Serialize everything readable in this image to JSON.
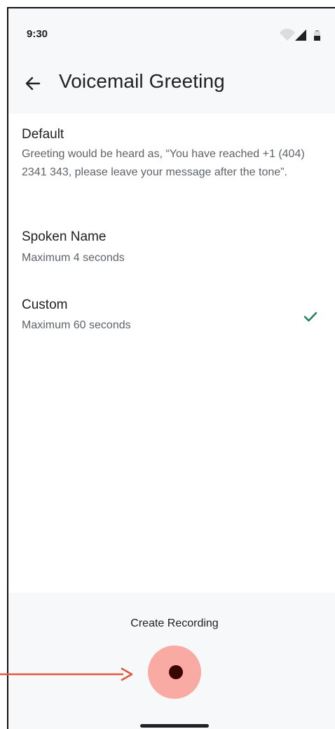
{
  "status_bar": {
    "time": "9:30",
    "icons": [
      "wifi-icon",
      "cellular-signal-icon",
      "battery-icon"
    ]
  },
  "header": {
    "back_icon": "arrow-left-icon",
    "title": "Voicemail Greeting"
  },
  "options": [
    {
      "title": "Default",
      "description": "Greeting would be heard as, “You have reached +1 (404) 2341 343, please leave your message after the tone”.",
      "selected": false
    },
    {
      "title": "Spoken Name",
      "description": "Maximum 4 seconds",
      "selected": false
    },
    {
      "title": "Custom",
      "description": "Maximum 60 seconds",
      "selected": true,
      "selected_icon": "check-icon"
    }
  ],
  "recording": {
    "label": "Create Recording",
    "button_icon": "record-icon"
  },
  "annotation": {
    "icon": "arrow-right-icon"
  },
  "colors": {
    "background": "#ffffff",
    "surface": "#f6f8f9",
    "primary_text": "#202124",
    "secondary_text": "#5f6368",
    "accent_check": "#1a7f5a",
    "record_halo": "#f8aaa3",
    "record_dot": "#3a0505",
    "annotation_arrow": "#e4573f"
  }
}
